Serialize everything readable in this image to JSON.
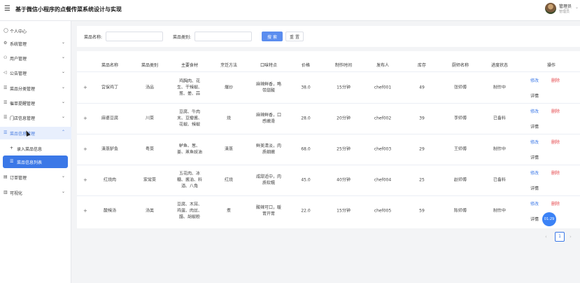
{
  "header": {
    "menu_icon": "menu-icon",
    "title": "基于微信小程序的点餐传菜系统设计与实现",
    "user_name": "管理员",
    "user_role": "管理员"
  },
  "sidebar": {
    "items": [
      {
        "label": "个人中心",
        "icon": "user-icon",
        "has_children": false
      },
      {
        "label": "系统管理",
        "icon": "gear-icon",
        "has_children": true
      },
      {
        "label": "用户管理",
        "icon": "users-icon",
        "has_children": true
      },
      {
        "label": "公告管理",
        "icon": "megaphone-icon",
        "has_children": true
      },
      {
        "label": "菜品分类管理",
        "icon": "list-icon",
        "has_children": true
      },
      {
        "label": "催单提醒管理",
        "icon": "list-icon",
        "has_children": true
      },
      {
        "label": "门店信息管理",
        "icon": "list-icon",
        "has_children": true
      },
      {
        "label": "菜品信息管理",
        "icon": "list-icon",
        "has_children": true,
        "expanded": true
      },
      {
        "label": "订单管理",
        "icon": "receipt-icon",
        "has_children": true
      },
      {
        "label": "可视化",
        "icon": "chart-icon",
        "has_children": true
      }
    ],
    "subitems": [
      {
        "label": "录入菜品信息",
        "icon": "plus-icon"
      },
      {
        "label": "菜品信息列表",
        "icon": "list-icon",
        "active": true
      }
    ]
  },
  "search": {
    "name_label": "菜品名称:",
    "name_placeholder": "",
    "category_label": "菜品类别:",
    "category_placeholder": "",
    "search_button": "搜 索",
    "reset_button": "重 置"
  },
  "table": {
    "columns": [
      "菜品名称",
      "菜品类别",
      "主要食材",
      "烹饪方法",
      "口味特点",
      "价格",
      "制作时间",
      "发布人",
      "库存",
      "厨师名称",
      "进度状态",
      "操作"
    ],
    "rows": [
      {
        "name": "宫保鸡丁",
        "category": "汤品",
        "ingredients": [
          "鸡胸肉、花",
          "生、干辣椒、",
          "葱、姜、蒜"
        ],
        "method": "爆炒",
        "taste": [
          "麻辣鲜香，略",
          "带甜酸"
        ],
        "price": "38.0",
        "time": "15分钟",
        "publisher": "chef001",
        "stock": "49",
        "chef": "张师傅",
        "status": "制作中"
      },
      {
        "name": "麻婆豆腐",
        "category": "川菜",
        "ingredients": [
          "豆腐、牛肉",
          "末、豆瓣酱、",
          "花椒、辣椒"
        ],
        "method": "烧",
        "taste": [
          "麻辣鲜香，口",
          "感嫩滑"
        ],
        "price": "28.0",
        "time": "20分钟",
        "publisher": "chef002",
        "stock": "39",
        "chef": "李师傅",
        "status": "已备料"
      },
      {
        "name": "清蒸鲈鱼",
        "category": "粤菜",
        "ingredients": [
          "鲈鱼、葱、",
          "姜、蒸鱼豉油"
        ],
        "method": "清蒸",
        "taste": [
          "鲜美清淡，肉",
          "质细嫩"
        ],
        "price": "68.0",
        "time": "25分钟",
        "publisher": "chef003",
        "stock": "29",
        "chef": "王师傅",
        "status": "制作中"
      },
      {
        "name": "红烧肉",
        "category": "家常菜",
        "ingredients": [
          "五花肉、冰",
          "糖、酱油、料",
          "酒、八角"
        ],
        "method": "红烧",
        "taste": [
          "咸甜适中，肉",
          "质软糯"
        ],
        "price": "45.0",
        "time": "40分钟",
        "publisher": "chef004",
        "stock": "25",
        "chef": "赵师傅",
        "status": "已备料"
      },
      {
        "name": "酸辣汤",
        "category": "汤类",
        "ingredients": [
          "豆腐、木耳、",
          "鸡蛋、肉丝、",
          "醋、胡椒粉"
        ],
        "method": "煮",
        "taste": [
          "酸辣可口，暖",
          "胃开胃"
        ],
        "price": "22.0",
        "time": "15分钟",
        "publisher": "chef005",
        "stock": "59",
        "chef": "陈师傅",
        "status": "制作中"
      }
    ],
    "actions": {
      "edit": "修改",
      "delete": "删除",
      "detail": "详情"
    },
    "expand_symbol": "+"
  },
  "pagination": {
    "current_page": "1",
    "prev_icon": "chevron-left-icon",
    "next_icon": "chevron-right-icon"
  },
  "overlay": {
    "timer": "01:29"
  },
  "colors": {
    "accent": "#3b78e7",
    "danger": "#e5484d",
    "sidebar_active_bg": "#e8effd"
  }
}
